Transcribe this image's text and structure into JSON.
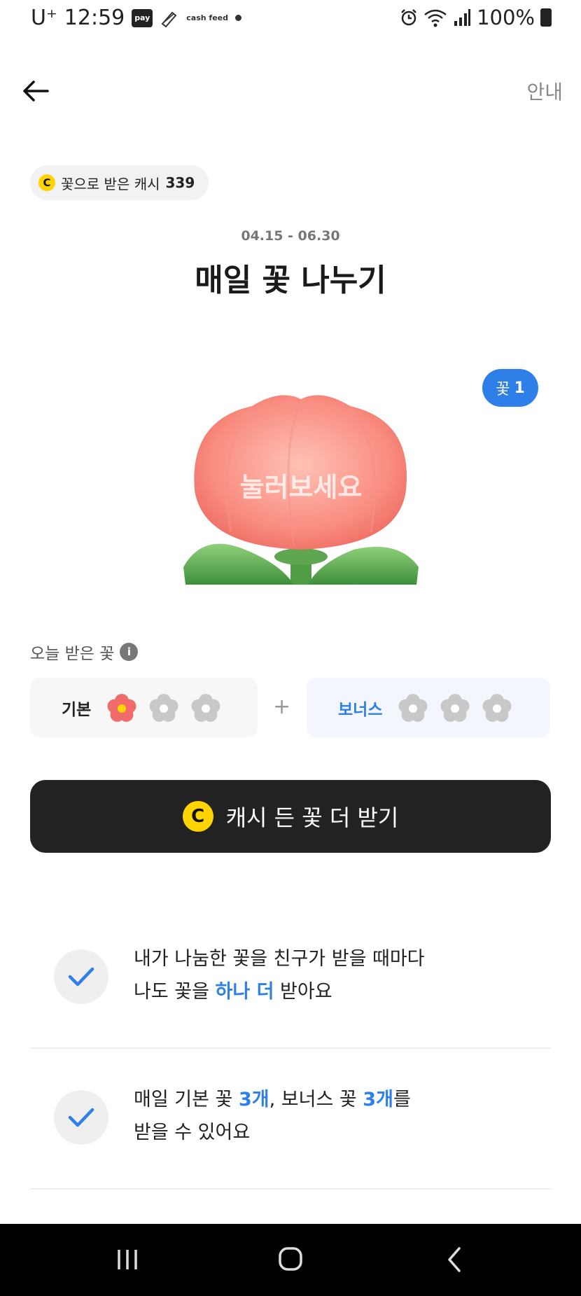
{
  "status_bar": {
    "carrier": "U⁺",
    "time": "12:59",
    "pay_badge": "pay",
    "cashfeed_label": "cash feed",
    "battery": "100%"
  },
  "header": {
    "back_icon": "arrow-left-icon",
    "guide_label": "안내"
  },
  "cash_pill": {
    "coin_symbol": "C",
    "label": "꽃으로 받은 캐시",
    "amount": "339"
  },
  "event": {
    "dates": "04.15 - 06.30",
    "title": "매일 꽃 나누기"
  },
  "flower_badge": {
    "label": "꽃",
    "count": "1"
  },
  "flower_overlay_text": "눌러보세요",
  "today_section": {
    "title": "오늘 받은 꽃",
    "info_symbol": "i",
    "basic": {
      "label": "기본",
      "received": 1,
      "total": 3
    },
    "plus": "+",
    "bonus": {
      "label": "보너스",
      "received": 0,
      "total": 3
    }
  },
  "cta": {
    "coin_symbol": "C",
    "label": "캐시 든 꽃 더 받기"
  },
  "benefits": [
    {
      "line1": "내가 나눔한 꽃을 친구가 받을 때마다",
      "line2_pre": "나도 꽃을 ",
      "line2_hl": "하나 더",
      "line2_post": " 받아요"
    },
    {
      "line1_pre": "매일 기본 꽃 ",
      "line1_hl1": "3개",
      "line1_mid": ", 보너스 꽃 ",
      "line1_hl2": "3개",
      "line1_post": "를",
      "line2": "받을 수 있어요"
    }
  ],
  "colors": {
    "accent_blue": "#2f7fe8",
    "coin_yellow": "#ffd400",
    "cta_background": "#222222",
    "flower_active": "#f26b6b",
    "flower_inactive": "#c8c8c8"
  },
  "nav_bar": {
    "recents_icon": "recents-icon",
    "home_icon": "home-icon",
    "back_icon": "back-chevron-icon"
  }
}
